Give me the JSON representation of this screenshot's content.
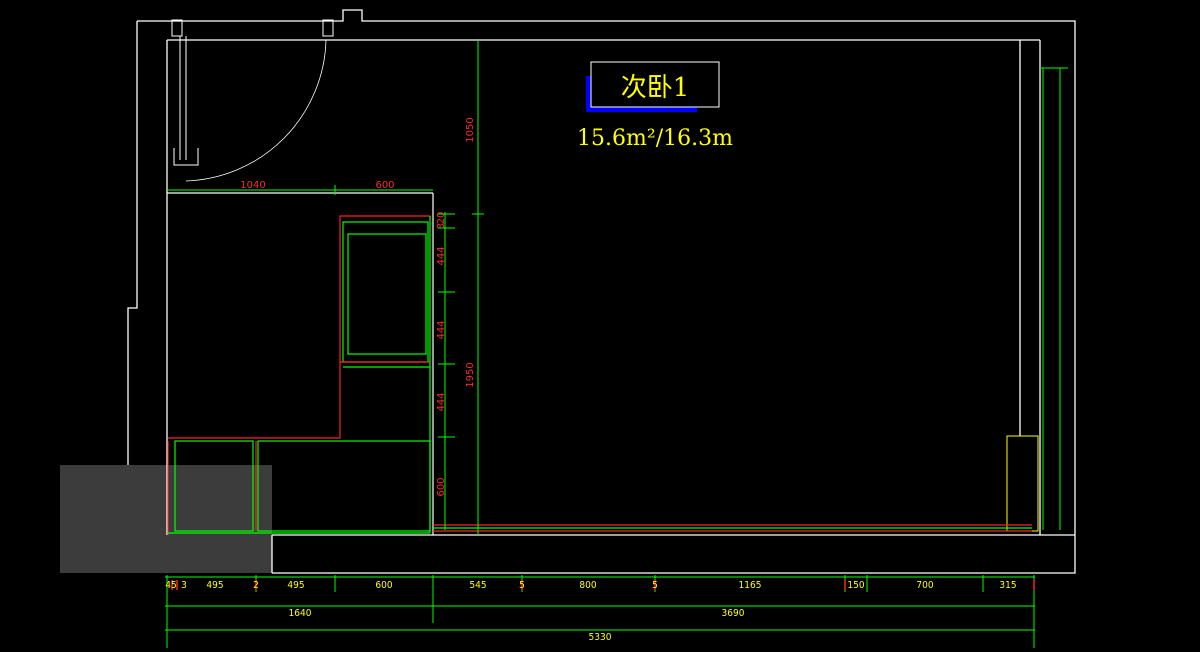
{
  "room": {
    "name": "次卧1",
    "area": "15.6m²/16.3m"
  },
  "cabinet_dims": {
    "top_left": "1040",
    "top_right": "600",
    "v_top": "1050",
    "v_mid": "1950"
  },
  "side_dims": [
    "20",
    "3",
    "444",
    "444",
    "444",
    "600"
  ],
  "bottom_dims": {
    "row1": [
      "45",
      "3",
      "495",
      "2",
      "495",
      "600",
      "545",
      "5",
      "800",
      "5",
      "1165",
      "150",
      "700",
      "315"
    ],
    "row2": [
      "1640",
      "3690"
    ],
    "row3": [
      "5330"
    ]
  },
  "colors": {
    "background": "#000000",
    "wall": "#ffffff",
    "cabinet": "#00ff00",
    "red": "#ff0000",
    "text": "#ffff00",
    "grey": "#3c3c3c",
    "label_box": "#0000ff"
  }
}
